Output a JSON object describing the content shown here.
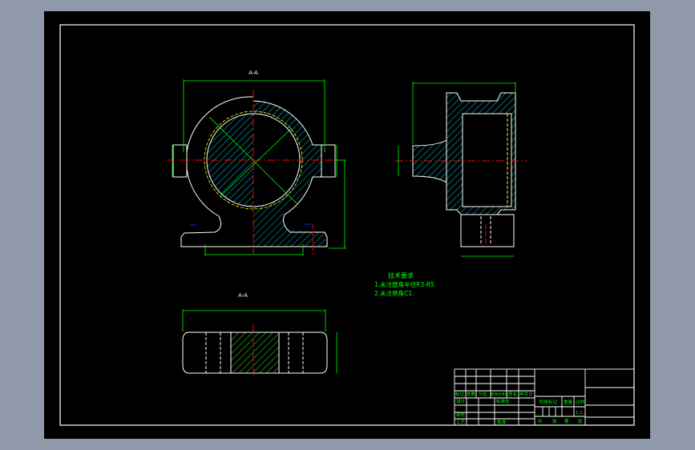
{
  "colors": {
    "background": "#8f99aa",
    "canvas": "#000000",
    "outline": "#ffffff",
    "dimension": "#00ff00",
    "centerline": "#ff0000",
    "hatch": "#00c8d8",
    "hidden": "#ffff00"
  },
  "views": {
    "section_label_top": "A-A",
    "section_label_bottom": "A-A"
  },
  "tech_requirements": {
    "title": "技术要求",
    "lines": [
      "1.未注圆角半径R3-R5",
      "2.未注倒角C1."
    ]
  },
  "title_block": {
    "row_headers": [
      "标记",
      "处数",
      "分区",
      "更改文件号",
      "签名",
      "年月日"
    ],
    "left_labels": [
      "设计",
      "审核",
      "工艺"
    ],
    "mid_labels": [
      "标准化",
      "批准"
    ],
    "stage_labels": [
      "阶段标记",
      "重量",
      "比例"
    ],
    "scale": "1:1",
    "sheet_labels": [
      "共",
      "张",
      "第",
      "张"
    ]
  }
}
